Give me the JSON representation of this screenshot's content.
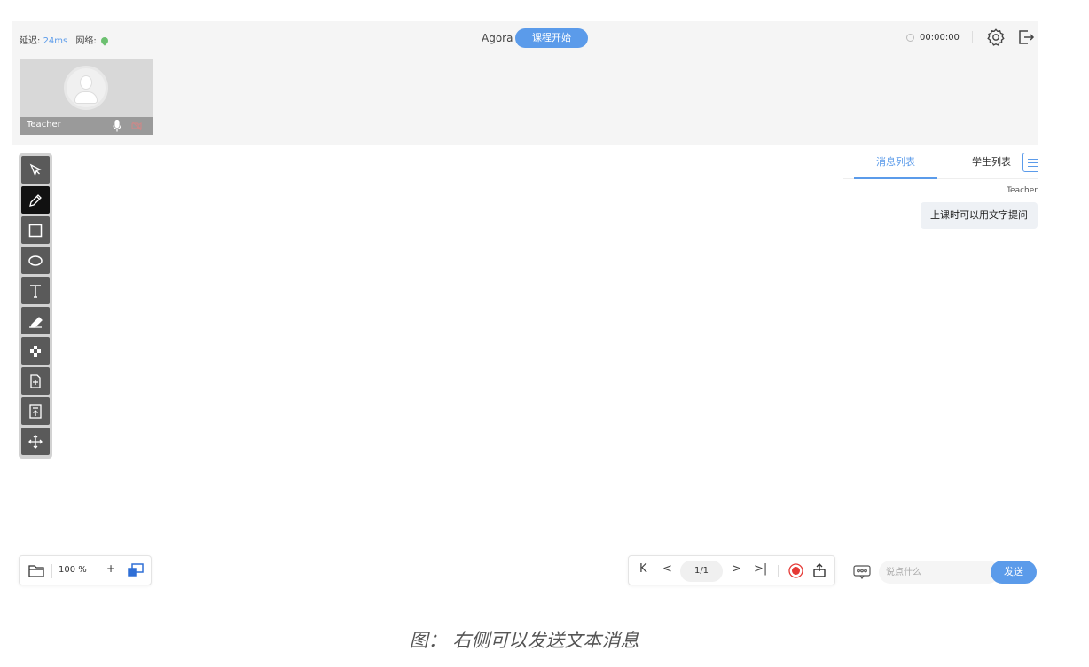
{
  "topbar": {
    "delay_label": "延迟:",
    "delay_value": "24ms",
    "network_label": "网络:",
    "room_name": "Agora",
    "start_button": "课程开始",
    "timer": "00:00:00"
  },
  "video": {
    "name": "Teacher"
  },
  "whiteboard": {
    "tools": [
      "selector-icon",
      "pencil-icon",
      "rectangle-icon",
      "ellipse-icon",
      "text-icon",
      "eraser-icon",
      "color-picker-icon",
      "add-page-icon",
      "upload-icon",
      "move-icon"
    ],
    "active_tool": "pencil-icon",
    "zoom": "100 %",
    "zoom_minus": "-",
    "zoom_plus": "+",
    "page_first": "K",
    "page_prev": "<",
    "page_indicator": "1/1",
    "page_next": ">",
    "page_last": ">|"
  },
  "chat": {
    "tab_messages": "消息列表",
    "tab_students": "学生列表",
    "message_sender": "Teacher",
    "message_text": "上课时可以用文字提问",
    "input_placeholder": "说点什么",
    "send_button": "发送"
  },
  "caption": "图： 右侧可以发送文本消息",
  "colors": {
    "accent": "#5b9bea",
    "record": "#e53935"
  }
}
